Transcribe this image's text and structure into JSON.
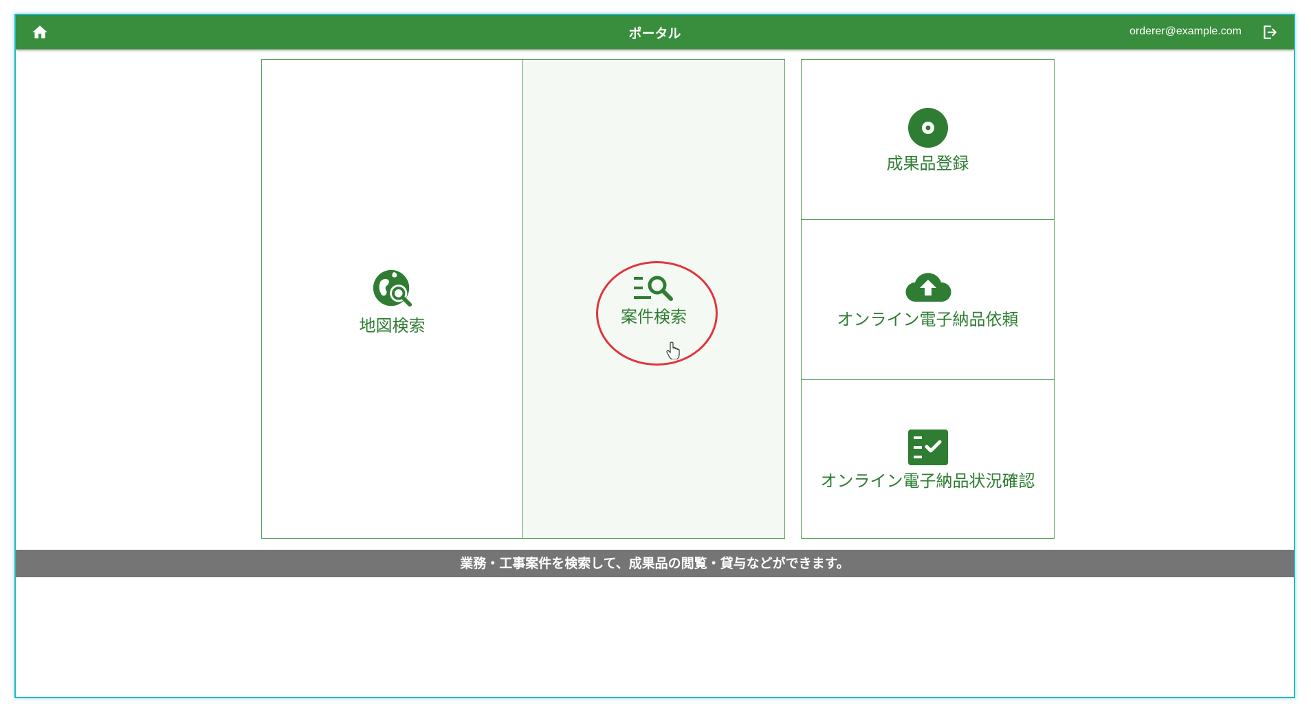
{
  "header": {
    "title": "ポータル",
    "user_email": "orderer@example.com",
    "home_icon": "home-icon",
    "logout_icon": "logout-icon"
  },
  "tiles": [
    {
      "label": "地図検索",
      "icon": "map-search-icon",
      "active": false
    },
    {
      "label": "案件検索",
      "icon": "list-search-icon",
      "active": true
    },
    {
      "label": "成果品登録",
      "icon": "disc-icon",
      "active": false
    },
    {
      "label": "オンライン電子納品依頼",
      "icon": "cloud-upload-icon",
      "active": false
    },
    {
      "label": "オンライン電子納品状況確認",
      "icon": "checklist-icon",
      "active": false
    }
  ],
  "info_bar": {
    "text": "業務・工事案件を検索して、成果品の閲覧・貸与などができます。"
  },
  "colors": {
    "header_bg": "#388e3c",
    "accent": "#2e7d32",
    "info_bar_bg": "#757575",
    "highlight": "#e0353d"
  }
}
